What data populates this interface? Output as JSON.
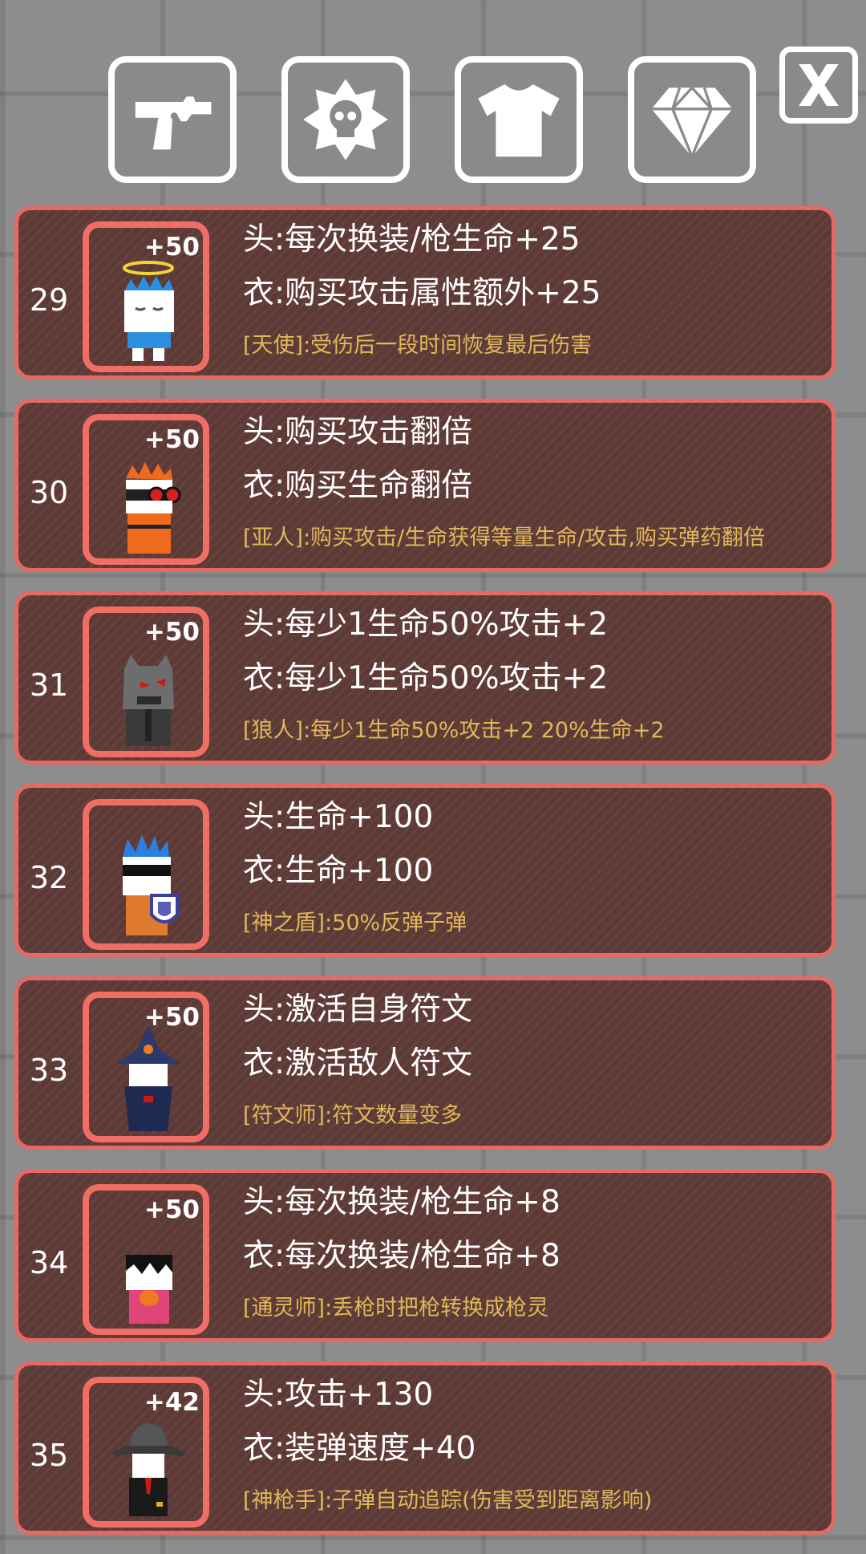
{
  "tabs": [
    {
      "icon": "revolver-icon"
    },
    {
      "icon": "skull-badge-icon"
    },
    {
      "icon": "tshirt-icon"
    },
    {
      "icon": "diamond-icon"
    }
  ],
  "close": {
    "label": "X"
  },
  "colors": {
    "card_border": "#e46a63",
    "card_bg": "#5e3a36",
    "skill_text": "#e0b85a"
  },
  "items": [
    {
      "num": "29",
      "bonus": "+50",
      "head": "头:每次换装/枪生命+25",
      "body": "衣:购买攻击属性额外+25",
      "skill": "[天使]:受伤后一段时间恢复最后伤害",
      "avatar": "angel-avatar"
    },
    {
      "num": "30",
      "bonus": "+50",
      "head": "头:购买攻击翻倍",
      "body": "衣:购买生命翻倍",
      "skill": "[亚人]:购买攻击/生命获得等量生命/攻击,购买弹药翻倍",
      "avatar": "demi-human-avatar"
    },
    {
      "num": "31",
      "bonus": "+50",
      "head": "头:每少1生命50%攻击+2",
      "body": "衣:每少1生命50%攻击+2",
      "skill": "[狼人]:每少1生命50%攻击+2 20%生命+2",
      "avatar": "werewolf-avatar"
    },
    {
      "num": "32",
      "bonus": "",
      "head": "头:生命+100",
      "body": "衣:生命+100",
      "skill": "[神之盾]:50%反弹子弹",
      "avatar": "shield-hero-avatar"
    },
    {
      "num": "33",
      "bonus": "+50",
      "head": "头:激活自身符文",
      "body": "衣:激活敌人符文",
      "skill": "[符文师]:符文数量变多",
      "avatar": "rune-master-avatar"
    },
    {
      "num": "34",
      "bonus": "+50",
      "head": "头:每次换装/枪生命+8",
      "body": "衣:每次换装/枪生命+8",
      "skill": "[通灵师]:丢枪时把枪转换成枪灵",
      "avatar": "necromancer-avatar"
    },
    {
      "num": "35",
      "bonus": "+42",
      "head": "头:攻击+130",
      "body": "衣:装弹速度+40",
      "skill": "[神枪手]:子弹自动追踪(伤害受到距离影响)",
      "avatar": "gunslinger-avatar"
    }
  ]
}
